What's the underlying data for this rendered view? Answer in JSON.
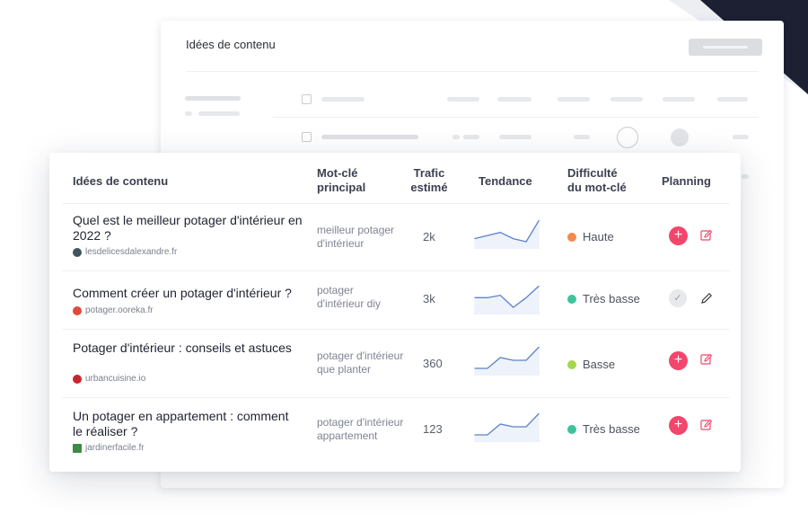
{
  "back_panel": {
    "title": "Idées de contenu"
  },
  "table": {
    "headers": {
      "idea": "Idées de contenu",
      "keyword": "Mot-clé\nprincipal",
      "traffic": "Trafic\nestimé",
      "trend": "Tendance",
      "difficulty": "Difficulté\ndu mot-clé",
      "planning": "Planning"
    },
    "rows": [
      {
        "title": "Quel est le meilleur potager d'intérieur en 2022 ?",
        "site": "lesdelicesdalexandre.fr",
        "site_icon": "site-favicon-dark",
        "keyword": "meilleur potager d'intérieur",
        "traffic": "2k",
        "trend": [
          3,
          4,
          5,
          3,
          2,
          9
        ],
        "difficulty": "Haute",
        "difficulty_color": "#f08b4d",
        "planning_state": "add"
      },
      {
        "title": "Comment créer un potager d'intérieur ?",
        "site": "potager.ooreka.fr",
        "site_icon": "owl-favicon",
        "keyword": "potager d'intérieur diy",
        "traffic": "3k",
        "trend": [
          4,
          4,
          5,
          0,
          4,
          9
        ],
        "difficulty": "Très basse",
        "difficulty_color": "#3fc49a",
        "planning_state": "planned"
      },
      {
        "title": "Potager d'intérieur : conseils et astuces",
        "site": "urbancuisine.io",
        "site_icon": "red-circle-favicon",
        "keyword": "potager d'intérieur que planter",
        "traffic": "360",
        "trend": [
          2,
          2,
          6,
          5,
          5,
          10
        ],
        "difficulty": "Basse",
        "difficulty_color": "#a6d64b",
        "planning_state": "add"
      },
      {
        "title": "Un potager en appartement : comment le réaliser ?",
        "site": "jardinerfacile.fr",
        "site_icon": "garden-favicon",
        "keyword": "potager d'intérieur appartement",
        "traffic": "123",
        "trend": [
          2,
          2,
          6,
          5,
          5,
          10
        ],
        "difficulty": "Très basse",
        "difficulty_color": "#3fc49a",
        "planning_state": "add"
      }
    ]
  },
  "colors": {
    "accent_pink": "#f2466d",
    "trend_line": "#5b82c7",
    "trend_fill": "#eef2fb",
    "corner_dark": "#1d1f33"
  }
}
